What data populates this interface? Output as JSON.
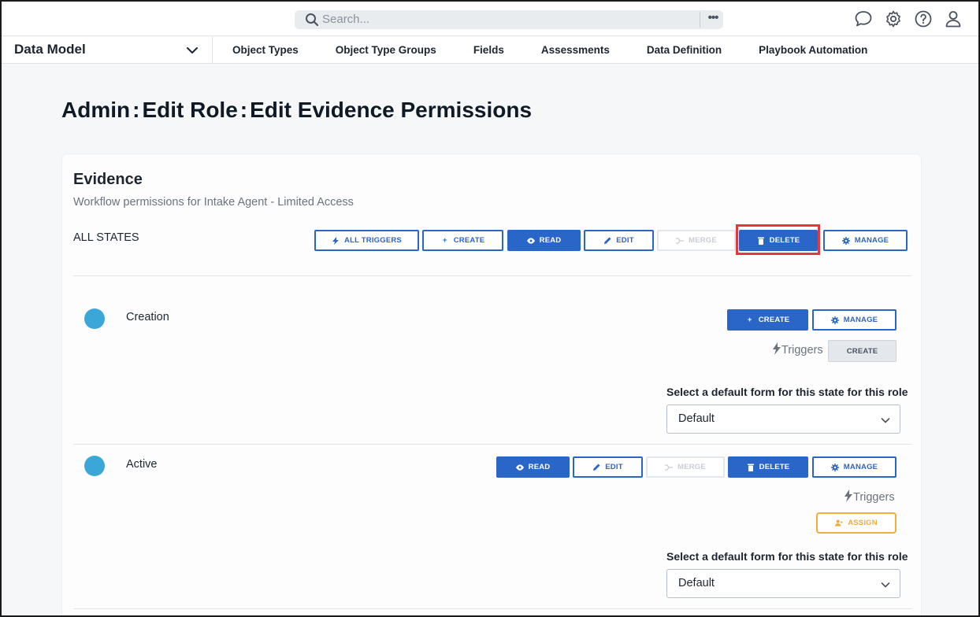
{
  "search": {
    "placeholder": "Search...",
    "more_label": "•••"
  },
  "top_icons": [
    "chat-icon",
    "gear-icon",
    "help-icon",
    "user-icon"
  ],
  "nav": {
    "module": "Data Model",
    "tabs": [
      "Object Types",
      "Object Type Groups",
      "Fields",
      "Assessments",
      "Data Definition",
      "Playbook Automation"
    ]
  },
  "page": {
    "title_parts": [
      "Admin",
      "Edit Role",
      "Edit Evidence Permissions"
    ],
    "separator": ":"
  },
  "card": {
    "title": "Evidence",
    "subtitle": "Workflow permissions for Intake Agent - Limited Access",
    "all_states_label": "ALL STATES",
    "all_states_buttons": {
      "all_triggers": "ALL TRIGGERS",
      "create": "CREATE",
      "read": "READ",
      "edit": "EDIT",
      "merge": "MERGE",
      "delete": "DELETE",
      "manage": "MANAGE"
    }
  },
  "states": [
    {
      "name": "Creation",
      "buttons": {
        "create": "CREATE",
        "manage": "MANAGE"
      },
      "triggers_label": "Triggers",
      "trigger_button": "CREATE",
      "select_label": "Select a default form for this state for this role",
      "select_value": "Default"
    },
    {
      "name": "Active",
      "buttons": {
        "read": "READ",
        "edit": "EDIT",
        "merge": "MERGE",
        "delete": "DELETE",
        "manage": "MANAGE"
      },
      "triggers_label": "Triggers",
      "trigger_button": "ASSIGN",
      "select_label": "Select a default form for this state for this role",
      "select_value": "Default"
    }
  ],
  "colors": {
    "primary": "#2a66c7",
    "highlight": "#e0393e",
    "state_dot": "#3aa7d8",
    "assign": "#f0ad3b"
  }
}
